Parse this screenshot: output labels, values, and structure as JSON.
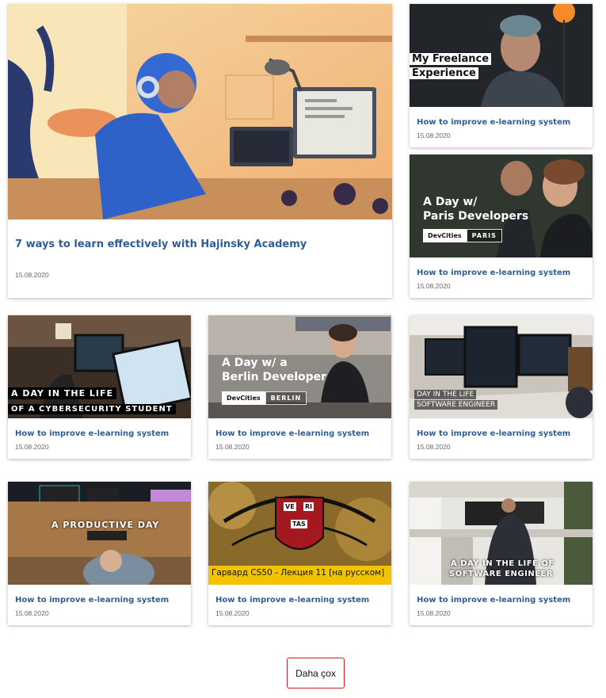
{
  "hero": {
    "title": "7 ways to learn effectively with Hajinsky Academy",
    "date": "15.08.2020"
  },
  "cards": [
    {
      "title": "How to improve e-learning system",
      "date": "15.08.2020",
      "overlay": [
        "My Freelance",
        "Experience"
      ]
    },
    {
      "title": "How to improve e-learning system",
      "date": "15.08.2020",
      "overlay": [
        "A Day w/",
        "Paris Developers"
      ],
      "badge": [
        "DevCities",
        "PARIS"
      ]
    },
    {
      "title": "How to improve e-learning system",
      "date": "15.08.2020",
      "overlay": [
        "A DAY IN THE LIFE",
        "OF A CYBERSECURITY STUDENT"
      ]
    },
    {
      "title": "How to improve e-learning system",
      "date": "15.08.2020",
      "overlay": [
        "A Day w/ a",
        "Berlin Developer"
      ],
      "badge": [
        "DevCities",
        "BERLIN"
      ]
    },
    {
      "title": "How to improve e-learning system",
      "date": "15.08.2020",
      "overlay": [
        "DAY IN THE LIFE",
        "SOFTWARE ENGINEER"
      ]
    },
    {
      "title": "How to improve e-learning system",
      "date": "15.08.2020",
      "overlay": [
        "A PRODUCTIVE DAY"
      ]
    },
    {
      "title": "How to improve e-learning system",
      "date": "15.08.2020",
      "overlay": [
        "VE",
        "RI",
        "TAS",
        "Гарвард CS50 - Лекция 11 [на русском]"
      ]
    },
    {
      "title": "How to improve e-learning system",
      "date": "15.08.2020",
      "overlay": [
        "A DAY IN THE LIFE OF",
        "SOFTWARE ENGINEER"
      ]
    }
  ],
  "more_button": {
    "label": "Daha çox"
  },
  "colors": {
    "title": "#2f5e95",
    "button_border": "#d31c1c"
  }
}
